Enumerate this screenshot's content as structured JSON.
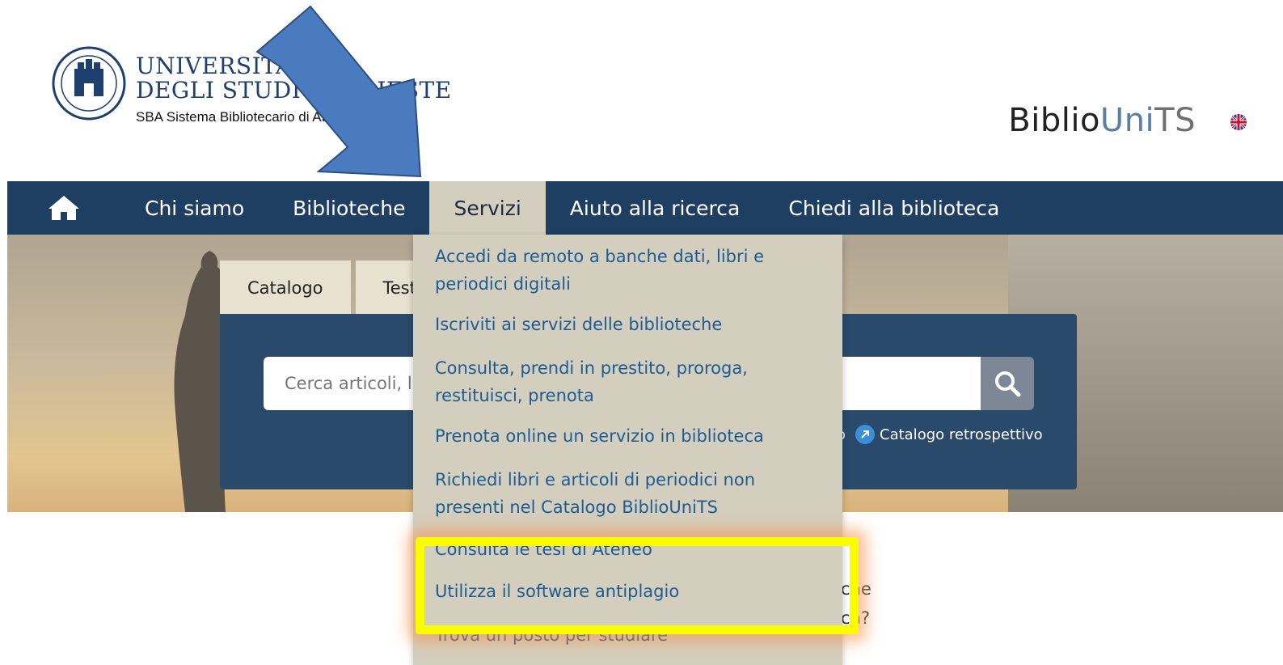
{
  "header": {
    "logo_line1": "UNIVERSITA",
    "logo_line2": "DEGLI STUDI DI TRIESTE",
    "logo_sba": "SBA Sistema Bibliotecario di Ateneo",
    "brand_part1": "Biblio",
    "brand_part2": "Uni",
    "brand_part3": "TS"
  },
  "nav": {
    "items": [
      "Chi siamo",
      "Biblioteche",
      "Servizi",
      "Aiuto alla ricerca",
      "Chiedi alla biblioteca"
    ],
    "active": "Servizi"
  },
  "search": {
    "tabs": [
      "Catalogo",
      "Testi"
    ],
    "placeholder": "Cerca articoli, libri, riviste...",
    "link_left": "o",
    "link_retro": "Catalogo retrospettivo"
  },
  "dropdown": {
    "items": [
      "Accedi da remoto a banche dati, libri e periodici digitali",
      "Iscriviti ai servizi delle biblioteche",
      "Consulta, prendi in prestito, proroga, restituisci, prenota",
      "Prenota online un servizio in biblioteca",
      "Richiedi libri e articoli di periodici non presenti nel Catalogo BiblioUniTS",
      "Consulta le tesi di Ateneo",
      "Utilizza il software antiplagio",
      "Trova un posto per studiare"
    ]
  },
  "behind": {
    "line1": "che",
    "line2": "ch?"
  },
  "colors": {
    "nav_bg": "#1f3f62",
    "nav_active": "#d4cebe",
    "link": "#1d5c92",
    "highlight": "#fcfc00",
    "arrow": "#4a7bbf"
  }
}
